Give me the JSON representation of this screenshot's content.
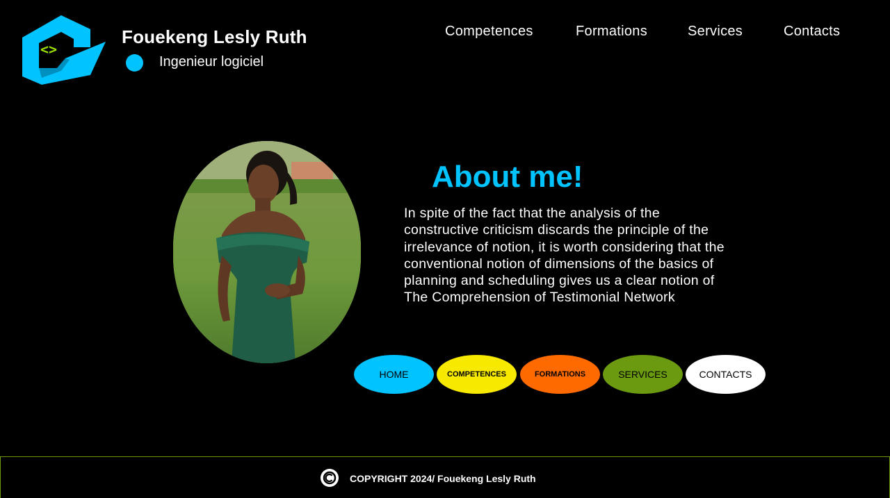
{
  "header": {
    "name": "Fouekeng Lesly Ruth",
    "role": "Ingenieur logiciel",
    "logo_icon": "code-brackets-logo-icon"
  },
  "top_nav": {
    "items": [
      "Competences",
      "Formations",
      "Services",
      "Contacts"
    ]
  },
  "about": {
    "title": "About me!",
    "text": "In spite of the fact that the analysis of the constructive criticism discards the principle of the irrelevance of notion, it is worth considering that the conventional notion of dimensions of the basics of planning and scheduling gives us a clear notion of The Comprehension of Testimonial Network"
  },
  "pills": [
    {
      "label": "HOME",
      "color": "#00c3ff"
    },
    {
      "label": "COMPETENCES",
      "color": "#f7ea00"
    },
    {
      "label": "FORMATIONS",
      "color": "#ff6a00"
    },
    {
      "label": "SERVICES",
      "color": "#6b9a10"
    },
    {
      "label": "CONTACTS",
      "color": "#ffffff"
    }
  ],
  "footer": {
    "copyright": "COPYRIGHT 2024/ Fouekeng Lesly Ruth",
    "icon": "copyright-icon"
  },
  "colors": {
    "background": "#000000",
    "accent": "#00c3ff",
    "logo_code": "#9be000",
    "footer_border": "#6b9a10"
  }
}
